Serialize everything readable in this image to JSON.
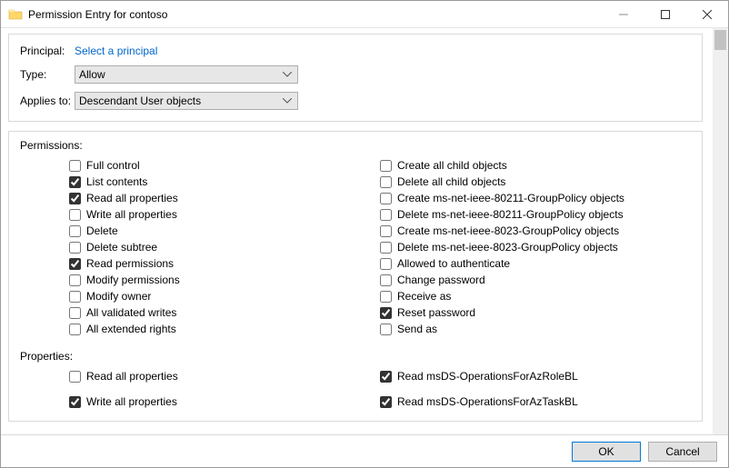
{
  "window": {
    "title": "Permission Entry for contoso"
  },
  "header": {
    "principal_label": "Principal:",
    "principal_link": "Select a principal",
    "type_label": "Type:",
    "type_value": "Allow",
    "applies_label": "Applies to:",
    "applies_value": "Descendant User objects"
  },
  "permissions": {
    "label": "Permissions:",
    "left": [
      {
        "label": "Full control",
        "checked": false
      },
      {
        "label": "List contents",
        "checked": true
      },
      {
        "label": "Read all properties",
        "checked": true
      },
      {
        "label": "Write all properties",
        "checked": false
      },
      {
        "label": "Delete",
        "checked": false
      },
      {
        "label": "Delete subtree",
        "checked": false
      },
      {
        "label": "Read permissions",
        "checked": true
      },
      {
        "label": "Modify permissions",
        "checked": false
      },
      {
        "label": "Modify owner",
        "checked": false
      },
      {
        "label": "All validated writes",
        "checked": false
      },
      {
        "label": "All extended rights",
        "checked": false
      }
    ],
    "right": [
      {
        "label": "Create all child objects",
        "checked": false
      },
      {
        "label": "Delete all child objects",
        "checked": false
      },
      {
        "label": "Create ms-net-ieee-80211-GroupPolicy objects",
        "checked": false
      },
      {
        "label": "Delete ms-net-ieee-80211-GroupPolicy objects",
        "checked": false
      },
      {
        "label": "Create ms-net-ieee-8023-GroupPolicy objects",
        "checked": false
      },
      {
        "label": "Delete ms-net-ieee-8023-GroupPolicy objects",
        "checked": false
      },
      {
        "label": "Allowed to authenticate",
        "checked": false
      },
      {
        "label": "Change password",
        "checked": false
      },
      {
        "label": "Receive as",
        "checked": false
      },
      {
        "label": "Reset password",
        "checked": true
      },
      {
        "label": "Send as",
        "checked": false
      }
    ]
  },
  "properties": {
    "label": "Properties:",
    "left": [
      {
        "label": "Read all properties",
        "checked": false
      },
      {
        "label": "Write all properties",
        "checked": true
      }
    ],
    "right": [
      {
        "label": "Read msDS-OperationsForAzRoleBL",
        "checked": true
      },
      {
        "label": "Read msDS-OperationsForAzTaskBL",
        "checked": true
      }
    ]
  },
  "buttons": {
    "ok": "OK",
    "cancel": "Cancel"
  }
}
